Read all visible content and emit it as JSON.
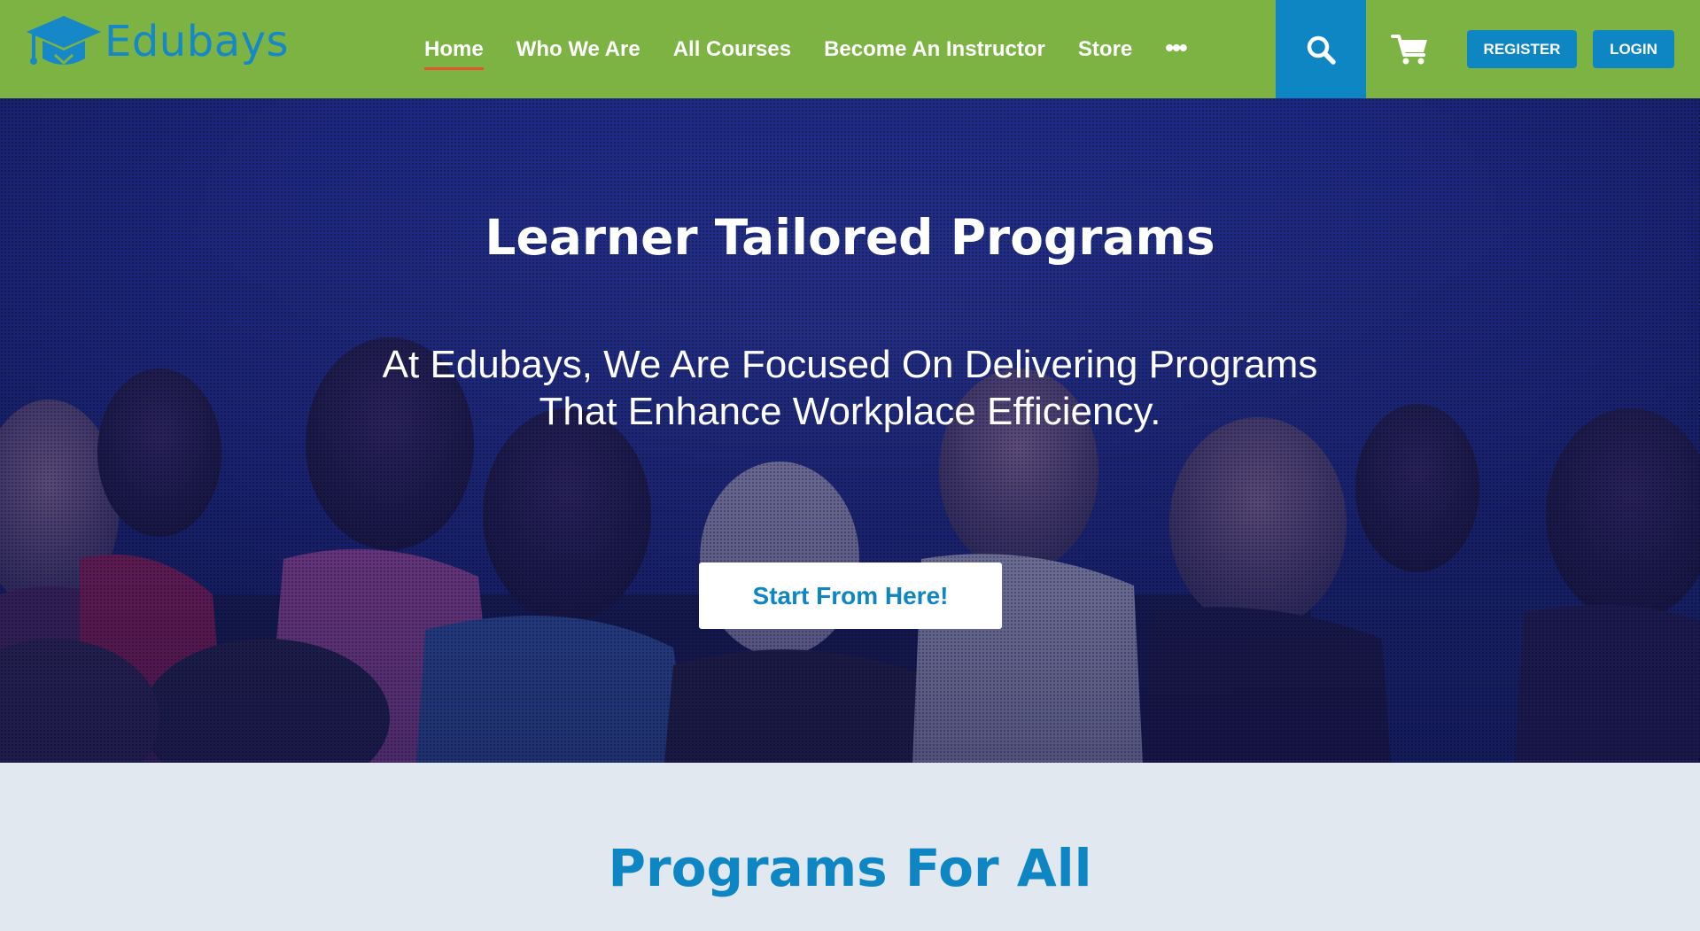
{
  "brand": {
    "name": "Edubays",
    "logo_icon": "graduation-cap-icon",
    "color": "#1688c8"
  },
  "colors": {
    "header_bg": "#7cb342",
    "accent": "#0f86c4",
    "active_underline": "#e4572e",
    "section_bg": "#e2e8f0"
  },
  "nav": {
    "items": [
      {
        "label": "Home",
        "active": true
      },
      {
        "label": "Who We Are",
        "active": false
      },
      {
        "label": "All Courses",
        "active": false
      },
      {
        "label": "Become An Instructor",
        "active": false
      },
      {
        "label": "Store",
        "active": false
      }
    ],
    "more_label": "•••"
  },
  "header_actions": {
    "search_icon": "search-icon",
    "cart_icon": "shopping-cart-icon",
    "register_label": "REGISTER",
    "login_label": "LOGIN"
  },
  "hero": {
    "title": "Learner Tailored Programs",
    "subtitle": "At Edubays, We Are Focused On Delivering Programs That Enhance Workplace Efficiency.",
    "cta_label": "Start From Here!"
  },
  "programs": {
    "title": "Programs For All"
  }
}
